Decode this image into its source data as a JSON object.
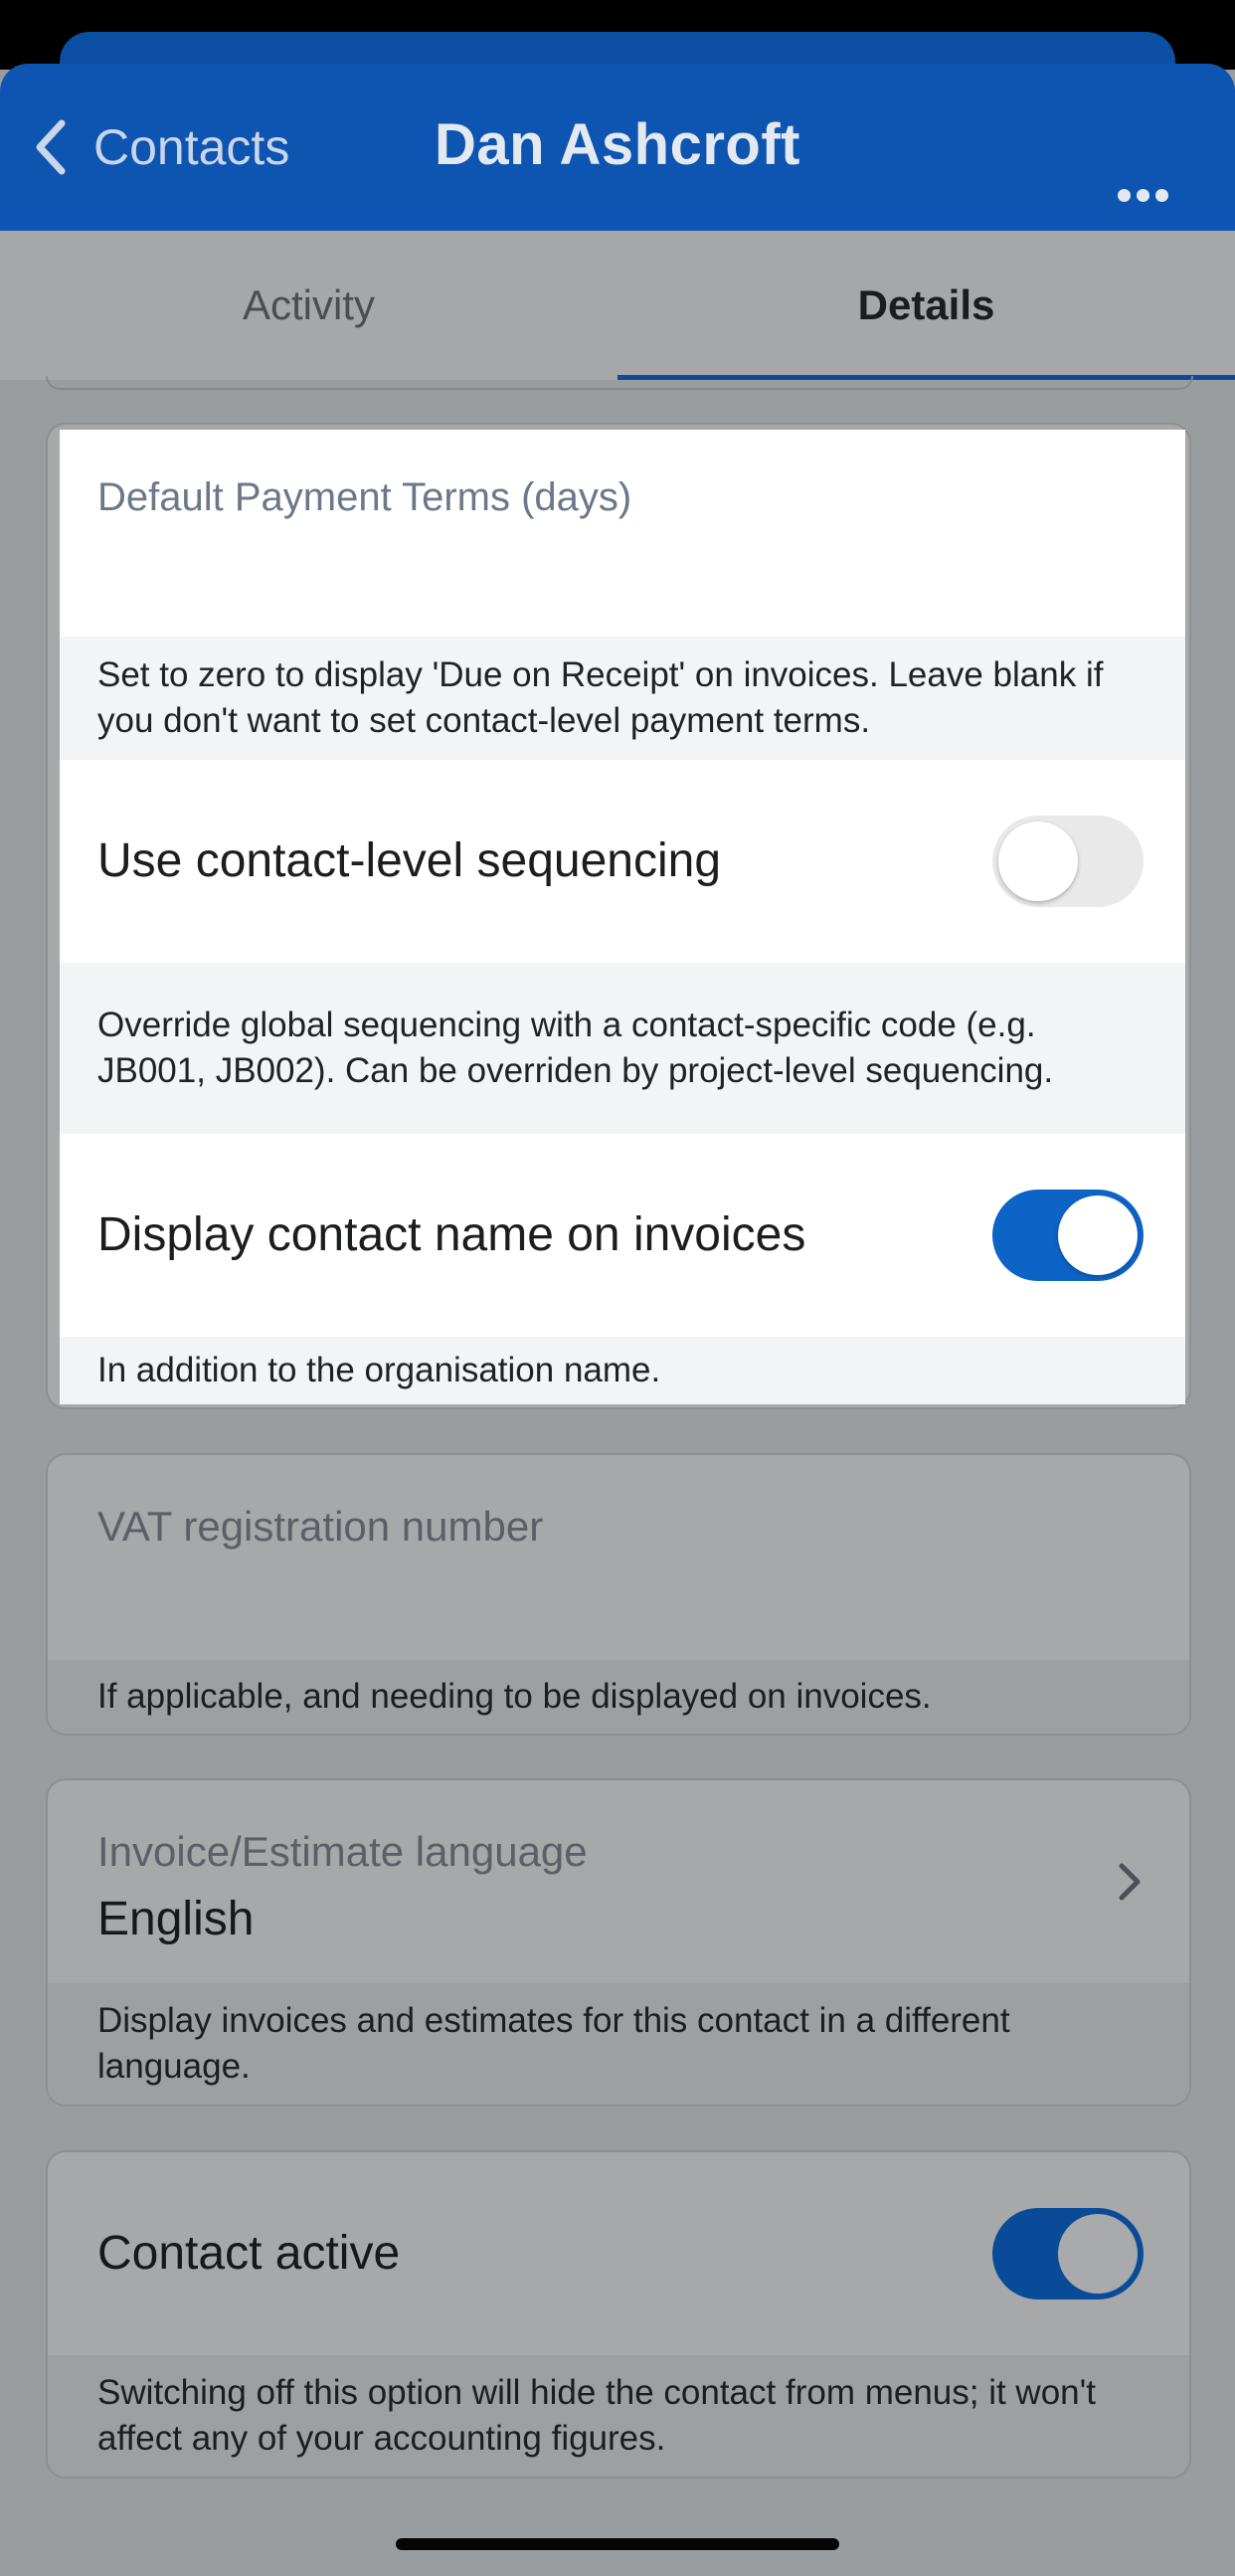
{
  "nav": {
    "back_label": "Contacts",
    "title": "Dan Ashcroft",
    "more_icon": "ellipsis-icon"
  },
  "tabs": [
    {
      "label": "Activity",
      "selected": false
    },
    {
      "label": "Details",
      "selected": true
    }
  ],
  "modal": {
    "payment_terms": {
      "label": "Default Payment Terms (days)",
      "value": "",
      "helper": "Set to zero to display 'Due on Receipt' on invoices. Leave blank if you don't want to set contact-level payment terms."
    },
    "sequencing": {
      "label": "Use contact-level sequencing",
      "on": false,
      "helper": "Override global sequencing with a contact-specific code (e.g. JB001, JB002). Can be overriden by project-level sequencing."
    },
    "display_name": {
      "label": "Display contact name on invoices",
      "on": true,
      "helper": "In addition to the organisation name."
    }
  },
  "background": {
    "vat": {
      "label": "VAT registration number",
      "helper": "If applicable, and needing to be displayed on invoices."
    },
    "language": {
      "label": "Invoice/Estimate language",
      "value": "English",
      "helper": "Display invoices and estimates for this contact in a different language."
    },
    "contact_active": {
      "label": "Contact active",
      "on": true,
      "helper": "Switching off this option will hide the contact from menus; it won't affect any of your accounting figures."
    }
  },
  "colors": {
    "brand_blue": "#0d55b0",
    "toggle_on": "#0e63c7",
    "toggle_off": "#e9e9ea",
    "overlay_gray": "#9a9d9f"
  }
}
